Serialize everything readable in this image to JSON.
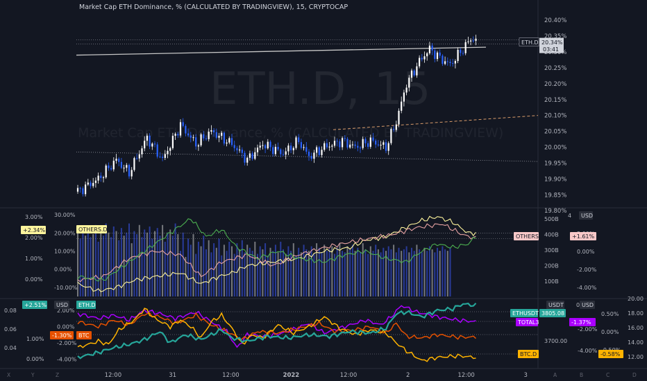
{
  "header": {
    "title": "Market Cap ETH Dominance, % (CALCULATED BY TRADINGVIEW), 15, CRYPTOCAP"
  },
  "watermark": {
    "symbol": "ETH.D, 15",
    "description": "Market Cap ETH Dominance, % (CALCULATED BY TRADINGVIEW)"
  },
  "colors": {
    "background": "#131722",
    "grid": "#2a2e39",
    "axis_text": "#b2b5be",
    "candle_up": "#ffffff",
    "candle_down": "#2962ff",
    "others_d": "#fff59d",
    "others": "#e8a3a3",
    "total3": "#aa00ff",
    "ethusdt": "#26a69a",
    "btc_d": "#ffb300",
    "btc": "#e65100",
    "eth_d": "#26a69a",
    "green_line": "#4caf50"
  },
  "chart_data": [
    {
      "type": "candlestick",
      "name": "ETH.D",
      "ylim": [
        19.82,
        20.42
      ],
      "y_ticks": [
        "20.40%",
        "20.35%",
        "20.30%",
        "20.25%",
        "20.20%",
        "20.15%",
        "20.10%",
        "20.05%",
        "20.00%",
        "19.95%",
        "19.90%",
        "19.85%",
        "19.80%"
      ],
      "last_value": "20.34%",
      "countdown": "03:41",
      "label": "ETH.D",
      "anchors": [
        [
          0,
          19.86
        ],
        [
          8,
          19.9
        ],
        [
          15,
          19.96
        ],
        [
          20,
          19.92
        ],
        [
          27,
          20.03
        ],
        [
          33,
          19.96
        ],
        [
          40,
          20.07
        ],
        [
          46,
          20.01
        ],
        [
          52,
          20.05
        ],
        [
          60,
          20.01
        ],
        [
          66,
          19.96
        ],
        [
          72,
          20.01
        ],
        [
          80,
          19.98
        ],
        [
          86,
          20.02
        ],
        [
          90,
          19.97
        ],
        [
          96,
          20.0
        ],
        [
          103,
          20.02
        ],
        [
          108,
          20.0
        ],
        [
          114,
          20.02
        ],
        [
          120,
          20.0
        ],
        [
          124,
          20.08
        ],
        [
          128,
          20.2
        ],
        [
          133,
          20.27
        ],
        [
          137,
          20.31
        ],
        [
          141,
          20.28
        ],
        [
          145,
          20.26
        ],
        [
          149,
          20.3
        ],
        [
          153,
          20.34
        ],
        [
          155,
          20.34
        ]
      ]
    },
    {
      "type": "line",
      "name": "OTHERS panel",
      "left_ticks": [
        "3.00%",
        "2.00%",
        "1.00%",
        "0.00%"
      ],
      "mid_ticks": [
        "30.00%",
        "20.00%",
        "10.00%",
        "0.00%",
        "-10.00%"
      ],
      "vol_ticks": [
        "500B",
        "400B",
        "300B",
        "200B",
        "100B"
      ],
      "right_ticks": [
        "2.00%",
        "0.00%",
        "-2.00%",
        "-4.00%"
      ],
      "ylim": [
        -15,
        32
      ],
      "badges": {
        "left_value": "+2.34%",
        "others_d_label": "OTHERS.D",
        "others_label": "OTHERS",
        "others_value": "+1.61%",
        "unit": "USD",
        "top_tick": "4"
      },
      "series": [
        {
          "name": "OTHERS.D",
          "color_key": "others_d",
          "anchors": [
            [
              0,
              -8
            ],
            [
              8,
              -12
            ],
            [
              15,
              -10
            ],
            [
              22,
              -6
            ],
            [
              30,
              -4
            ],
            [
              40,
              -2
            ],
            [
              48,
              -8
            ],
            [
              55,
              -4
            ],
            [
              60,
              -2
            ],
            [
              66,
              2
            ],
            [
              76,
              4
            ],
            [
              86,
              6
            ],
            [
              96,
              10
            ],
            [
              106,
              12
            ],
            [
              112,
              16
            ],
            [
              120,
              18
            ],
            [
              126,
              22
            ],
            [
              134,
              27
            ],
            [
              140,
              29
            ],
            [
              146,
              26
            ],
            [
              152,
              20
            ],
            [
              155,
              20
            ]
          ]
        },
        {
          "name": "OTHERS",
          "color_key": "others",
          "anchors": [
            [
              0,
              -6
            ],
            [
              10,
              -4
            ],
            [
              20,
              6
            ],
            [
              30,
              10
            ],
            [
              40,
              8
            ],
            [
              48,
              -4
            ],
            [
              56,
              4
            ],
            [
              66,
              8
            ],
            [
              76,
              2
            ],
            [
              86,
              8
            ],
            [
              96,
              12
            ],
            [
              106,
              15
            ],
            [
              114,
              17
            ],
            [
              122,
              19
            ],
            [
              132,
              23
            ],
            [
              142,
              25
            ],
            [
              150,
              19
            ],
            [
              155,
              17
            ]
          ]
        },
        {
          "name": "",
          "color_key": "green_line",
          "anchors": [
            [
              0,
              -4
            ],
            [
              10,
              -6
            ],
            [
              20,
              4
            ],
            [
              30,
              14
            ],
            [
              36,
              20
            ],
            [
              44,
              28
            ],
            [
              50,
              18
            ],
            [
              56,
              22
            ],
            [
              62,
              12
            ],
            [
              70,
              6
            ],
            [
              78,
              10
            ],
            [
              86,
              6
            ],
            [
              96,
              4
            ],
            [
              104,
              8
            ],
            [
              112,
              10
            ],
            [
              120,
              6
            ],
            [
              128,
              4
            ],
            [
              134,
              10
            ],
            [
              140,
              14
            ],
            [
              146,
              12
            ],
            [
              152,
              14
            ],
            [
              155,
              18
            ]
          ]
        }
      ],
      "volume": [
        420,
        380,
        450,
        400,
        430,
        390,
        410,
        470,
        360,
        440,
        400,
        480,
        420,
        390,
        460,
        430,
        370,
        450,
        400,
        420,
        480,
        350,
        430,
        410,
        470,
        390,
        440,
        420,
        460,
        380,
        430,
        450,
        400,
        470,
        360,
        420,
        440,
        400,
        480,
        410,
        300,
        420,
        260,
        380,
        340,
        410,
        280,
        360,
        330,
        400,
        310,
        370,
        290,
        350,
        320,
        380,
        270,
        340,
        300,
        360,
        330,
        280,
        350,
        310,
        370,
        290,
        340,
        320,
        300,
        360,
        280,
        330,
        310,
        350,
        270,
        320,
        300,
        340,
        290,
        360,
        310,
        280,
        330,
        300,
        350,
        270,
        320,
        290,
        340,
        310,
        300,
        330,
        280,
        350,
        320,
        290,
        340,
        300,
        310,
        330,
        280,
        320,
        350,
        300,
        290,
        330,
        310,
        340,
        300,
        320,
        290,
        350,
        310,
        280,
        330,
        300,
        340,
        310,
        290,
        320,
        300,
        330,
        310,
        340,
        290,
        320,
        300,
        310,
        330,
        290,
        320,
        300,
        340,
        310,
        290,
        320,
        300,
        330,
        310,
        290,
        320,
        300,
        330,
        310,
        300,
        320
      ]
    },
    {
      "type": "line",
      "name": "ETH.D comparison panel",
      "left_ticks": [
        "0.08",
        "0.06",
        "0.04"
      ],
      "left2_ticks": [
        "2.00%",
        "0.00%",
        "-2.00%",
        "-4.00%"
      ],
      "left3_ticks": [
        "1.00%",
        "0.00%"
      ],
      "right_mid_ticks": [
        "-2.00%",
        "-4.00%"
      ],
      "right_ticks": [
        "0.50%",
        "0.00%",
        "-0.50%"
      ],
      "far_right_ticks": [
        "20.00",
        "18.00",
        "16.00",
        "14.00",
        "12.00"
      ],
      "price_tick": "3700.00",
      "ylim": [
        -5,
        3.2
      ],
      "badges": {
        "top_left_value": "+2.51%",
        "usd": "USD",
        "eth_d_label": "ETH.D",
        "usdt": "USDT",
        "zero": "0",
        "btc_value": "-1.30%",
        "btc_label": "BTC",
        "ethusdt_label": "ETHUSDT",
        "ethusdt_value": "3805.08",
        "total3_label": "TOTAL3",
        "total3_value": "-1.37%",
        "btc_d_label": "BTC.D",
        "btc_d_value": "-0.58%"
      },
      "series": [
        {
          "name": "TOTAL3",
          "color_key": "total3",
          "anchors": [
            [
              0,
              1.6
            ],
            [
              8,
              1.0
            ],
            [
              14,
              1.4
            ],
            [
              20,
              0.8
            ],
            [
              26,
              2.0
            ],
            [
              32,
              1.6
            ],
            [
              38,
              1.0
            ],
            [
              46,
              1.8
            ],
            [
              52,
              0.6
            ],
            [
              58,
              -0.6
            ],
            [
              62,
              -2.6
            ],
            [
              66,
              -1.0
            ],
            [
              74,
              -1.2
            ],
            [
              82,
              -0.6
            ],
            [
              90,
              0.4
            ],
            [
              96,
              -0.8
            ],
            [
              104,
              0.0
            ],
            [
              112,
              0.8
            ],
            [
              118,
              0.2
            ],
            [
              122,
              1.2
            ],
            [
              126,
              2.6
            ],
            [
              132,
              1.8
            ],
            [
              140,
              1.2
            ],
            [
              148,
              0.8
            ],
            [
              155,
              0.6
            ]
          ]
        },
        {
          "name": "BTC",
          "color_key": "btc",
          "anchors": [
            [
              0,
              0.6
            ],
            [
              8,
              0.0
            ],
            [
              14,
              0.8
            ],
            [
              20,
              0.2
            ],
            [
              26,
              1.6
            ],
            [
              32,
              1.2
            ],
            [
              38,
              0.4
            ],
            [
              46,
              1.4
            ],
            [
              52,
              0.2
            ],
            [
              58,
              -0.6
            ],
            [
              64,
              -1.6
            ],
            [
              70,
              -0.6
            ],
            [
              78,
              -0.8
            ],
            [
              86,
              -0.2
            ],
            [
              94,
              0.4
            ],
            [
              100,
              -0.6
            ],
            [
              108,
              -0.4
            ],
            [
              114,
              0.0
            ],
            [
              120,
              -0.8
            ],
            [
              124,
              0.4
            ],
            [
              128,
              -1.2
            ],
            [
              134,
              -1.4
            ],
            [
              140,
              -1.0
            ],
            [
              148,
              -1.3
            ],
            [
              155,
              -1.3
            ]
          ]
        },
        {
          "name": "BTC.D",
          "color_key": "btc_d",
          "anchors": [
            [
              0,
              -2.6
            ],
            [
              8,
              -1.8
            ],
            [
              12,
              -2.2
            ],
            [
              16,
              -0.4
            ],
            [
              22,
              0.8
            ],
            [
              26,
              2.2
            ],
            [
              30,
              1.0
            ],
            [
              36,
              0.0
            ],
            [
              40,
              0.8
            ],
            [
              44,
              0.0
            ],
            [
              48,
              -1.4
            ],
            [
              52,
              0.6
            ],
            [
              56,
              1.4
            ],
            [
              60,
              -0.2
            ],
            [
              64,
              -2.2
            ],
            [
              68,
              -1.0
            ],
            [
              72,
              -1.4
            ],
            [
              78,
              0.2
            ],
            [
              84,
              -0.8
            ],
            [
              90,
              0.0
            ],
            [
              96,
              1.2
            ],
            [
              102,
              -0.2
            ],
            [
              108,
              -1.0
            ],
            [
              114,
              -0.4
            ],
            [
              120,
              -0.8
            ],
            [
              124,
              -2.0
            ],
            [
              128,
              -3.0
            ],
            [
              134,
              -4.2
            ],
            [
              140,
              -3.8
            ],
            [
              148,
              -3.6
            ],
            [
              155,
              -3.8
            ]
          ]
        },
        {
          "name": "ETHUSDT",
          "color_key": "ethusdt",
          "anchors": [
            [
              0,
              -3.8
            ],
            [
              8,
              -3.2
            ],
            [
              14,
              -2.6
            ],
            [
              20,
              -2.2
            ],
            [
              26,
              -1.6
            ],
            [
              32,
              -0.6
            ],
            [
              36,
              -2.0
            ],
            [
              42,
              -1.0
            ],
            [
              48,
              -1.6
            ],
            [
              56,
              -0.4
            ],
            [
              60,
              -1.4
            ],
            [
              66,
              -1.8
            ],
            [
              74,
              -1.2
            ],
            [
              82,
              -1.4
            ],
            [
              90,
              -1.0
            ],
            [
              98,
              -1.2
            ],
            [
              106,
              -0.6
            ],
            [
              114,
              -0.8
            ],
            [
              120,
              -0.2
            ],
            [
              124,
              1.6
            ],
            [
              128,
              1.8
            ],
            [
              134,
              1.2
            ],
            [
              140,
              2.0
            ],
            [
              146,
              2.2
            ],
            [
              150,
              2.8
            ],
            [
              155,
              2.6
            ]
          ]
        }
      ]
    }
  ],
  "x_axis": {
    "labels": [
      {
        "text": "12:00",
        "idx": 14
      },
      {
        "text": "31",
        "idx": 37
      },
      {
        "text": "12:00",
        "idx": 60
      },
      {
        "text": "2022",
        "idx": 83
      },
      {
        "text": "12:00",
        "idx": 106
      },
      {
        "text": "2",
        "idx": 129
      },
      {
        "text": "12:00",
        "idx": 152
      },
      {
        "text": "3",
        "idx": 175
      }
    ],
    "corner_left": [
      "X",
      "Y",
      "Z"
    ],
    "corner_right": [
      "A",
      "B",
      "C",
      "D"
    ]
  }
}
